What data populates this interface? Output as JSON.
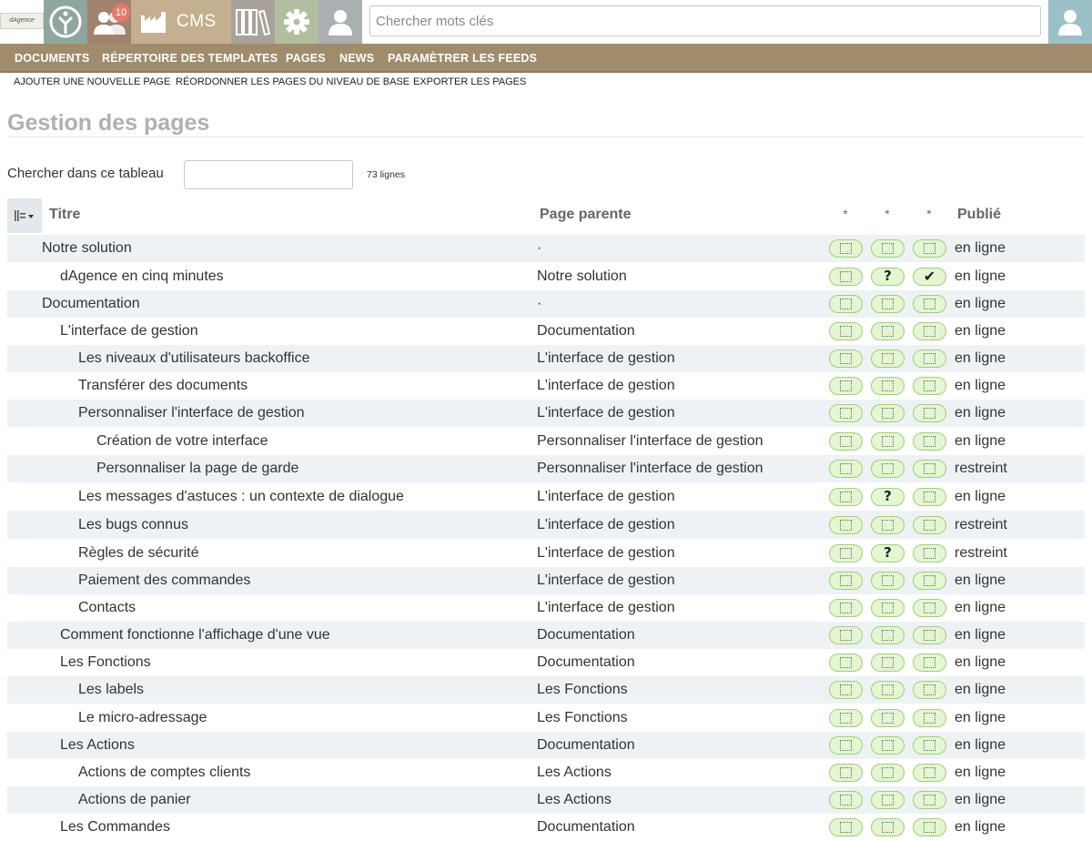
{
  "app": {
    "logo_text": "dAgence",
    "notifications_count": "10",
    "cms_label": "CMS",
    "search_placeholder": "Chercher mots clés"
  },
  "nav": {
    "items": [
      "DOCUMENTS",
      "RÉPERTOIRE DES TEMPLATES",
      "PAGES",
      "NEWS",
      "PARAMÈTRER LES FEEDS"
    ]
  },
  "subnav": {
    "items": [
      "AJOUTER UNE NOUVELLE PAGE",
      "RÉORDONNER LES PAGES DU NIVEAU DE BASE",
      "EXPORTER LES PAGES"
    ]
  },
  "page": {
    "title": "Gestion des pages",
    "filter_label": "Chercher dans ce tableau",
    "filter_value": "",
    "row_count": "73 lignes"
  },
  "table": {
    "headers": {
      "title": "Titre",
      "parent": "Page parente",
      "star": "*",
      "published": "Publié"
    },
    "rows": [
      {
        "title": "Notre solution",
        "level": 0,
        "parent": "·",
        "flags": [
          "box",
          "box",
          "box"
        ],
        "status": "en ligne"
      },
      {
        "title": "dAgence en cinq minutes",
        "level": 1,
        "parent": "Notre solution",
        "flags": [
          "box",
          "question",
          "check"
        ],
        "status": "en ligne"
      },
      {
        "title": "Documentation",
        "level": 0,
        "parent": "·",
        "flags": [
          "box",
          "box",
          "box"
        ],
        "status": "en ligne"
      },
      {
        "title": "L'interface de gestion",
        "level": 1,
        "parent": "Documentation",
        "flags": [
          "box",
          "box",
          "box"
        ],
        "status": "en ligne"
      },
      {
        "title": "Les niveaux d'utilisateurs backoffice",
        "level": 2,
        "parent": "L'interface de gestion",
        "flags": [
          "box",
          "box",
          "box"
        ],
        "status": "en ligne"
      },
      {
        "title": "Transférer des documents",
        "level": 2,
        "parent": "L'interface de gestion",
        "flags": [
          "box",
          "box",
          "box"
        ],
        "status": "en ligne"
      },
      {
        "title": "Personnaliser l'interface de gestion",
        "level": 2,
        "parent": "L'interface de gestion",
        "flags": [
          "box",
          "box",
          "box"
        ],
        "status": "en ligne"
      },
      {
        "title": "Création de votre interface",
        "level": 3,
        "parent": "Personnaliser l'interface de gestion",
        "flags": [
          "box",
          "box",
          "box"
        ],
        "status": "en ligne"
      },
      {
        "title": "Personnaliser la page de garde",
        "level": 3,
        "parent": "Personnaliser l'interface de gestion",
        "flags": [
          "box",
          "box",
          "box"
        ],
        "status": "restreint"
      },
      {
        "title": "Les messages d'astuces : un contexte de dialogue",
        "level": 2,
        "parent": "L'interface de gestion",
        "flags": [
          "box",
          "question",
          "box"
        ],
        "status": "en ligne"
      },
      {
        "title": "Les bugs connus",
        "level": 2,
        "parent": "L'interface de gestion",
        "flags": [
          "box",
          "box",
          "box"
        ],
        "status": "restreint"
      },
      {
        "title": "Règles de sécurité",
        "level": 2,
        "parent": "L'interface de gestion",
        "flags": [
          "box",
          "question",
          "box"
        ],
        "status": "restreint"
      },
      {
        "title": "Paiement des commandes",
        "level": 2,
        "parent": "L'interface de gestion",
        "flags": [
          "box",
          "box",
          "box"
        ],
        "status": "en ligne"
      },
      {
        "title": "Contacts",
        "level": 2,
        "parent": "L'interface de gestion",
        "flags": [
          "box",
          "box",
          "box"
        ],
        "status": "en ligne"
      },
      {
        "title": "Comment fonctionne l'affichage d'une vue",
        "level": 1,
        "parent": "Documentation",
        "flags": [
          "box",
          "box",
          "box"
        ],
        "status": "en ligne"
      },
      {
        "title": "Les Fonctions",
        "level": 1,
        "parent": "Documentation",
        "flags": [
          "box",
          "box",
          "box"
        ],
        "status": "en ligne"
      },
      {
        "title": "Les labels",
        "level": 2,
        "parent": "Les Fonctions",
        "flags": [
          "box",
          "box",
          "box"
        ],
        "status": "en ligne"
      },
      {
        "title": "Le micro-adressage",
        "level": 2,
        "parent": "Les Fonctions",
        "flags": [
          "box",
          "box",
          "box"
        ],
        "status": "en ligne"
      },
      {
        "title": "Les Actions",
        "level": 1,
        "parent": "Documentation",
        "flags": [
          "box",
          "box",
          "box"
        ],
        "status": "en ligne"
      },
      {
        "title": "Actions de comptes clients",
        "level": 2,
        "parent": "Les Actions",
        "flags": [
          "box",
          "box",
          "box"
        ],
        "status": "en ligne"
      },
      {
        "title": "Actions de panier",
        "level": 2,
        "parent": "Les Actions",
        "flags": [
          "box",
          "box",
          "box"
        ],
        "status": "en ligne"
      },
      {
        "title": "Les Commandes",
        "level": 1,
        "parent": "Documentation",
        "flags": [
          "box",
          "box",
          "box"
        ],
        "status": "en ligne"
      }
    ]
  }
}
